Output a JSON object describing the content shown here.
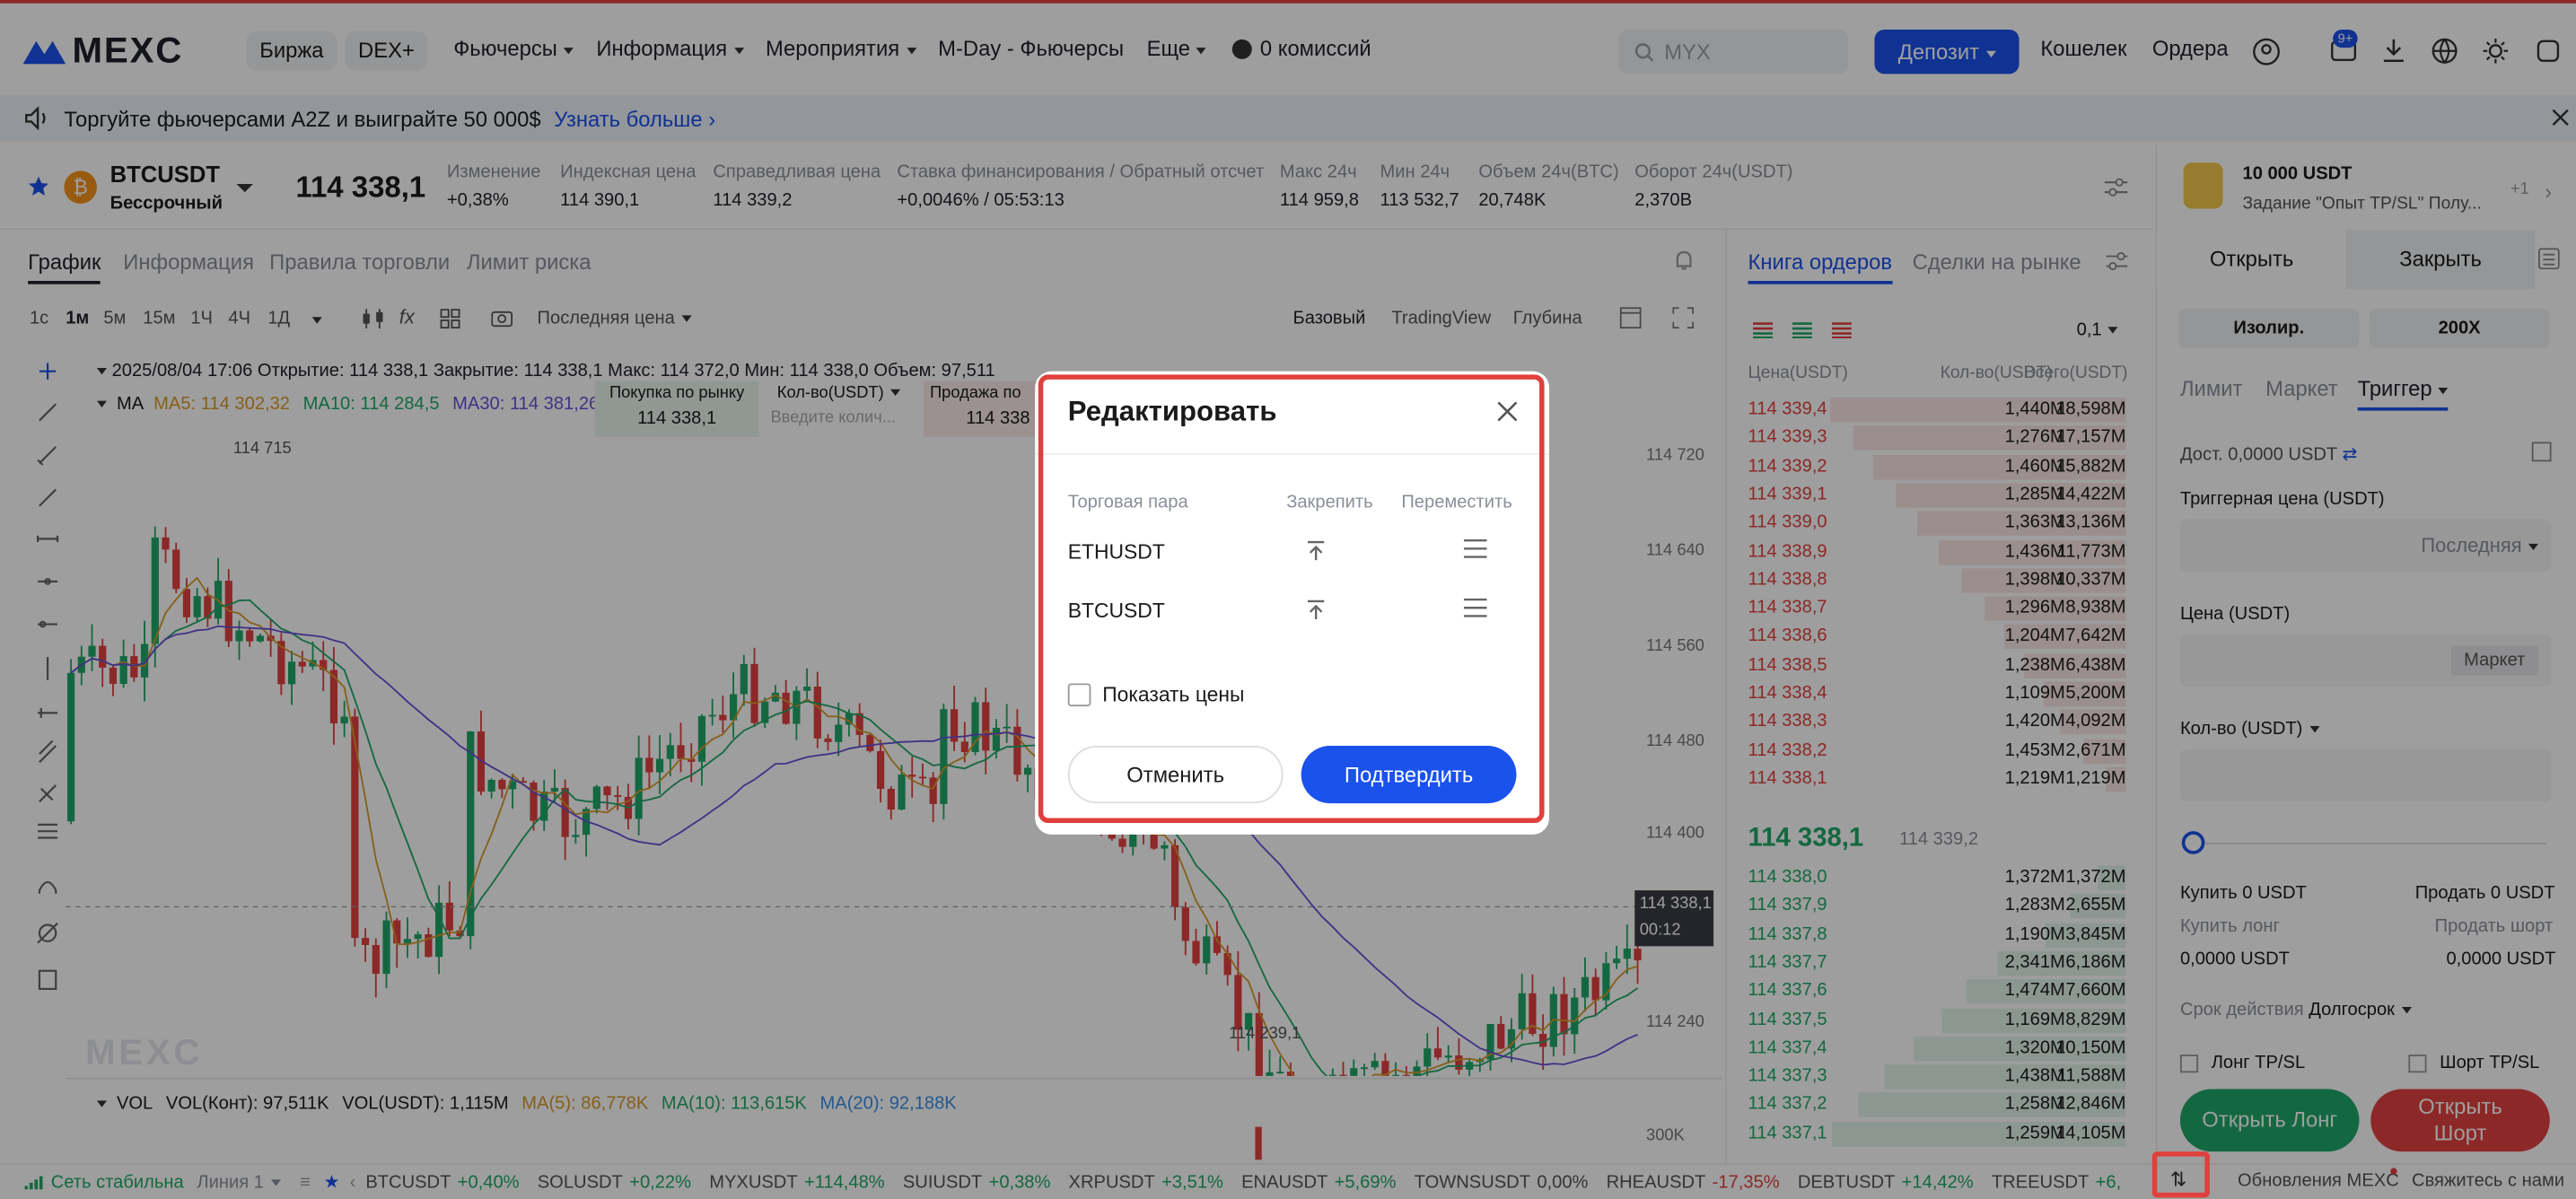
{
  "nav": {
    "logo": "MEXC",
    "items": [
      "Биржа",
      "DEX+",
      "Фьючерсы",
      "Информация",
      "Мероприятия",
      "M-Day - Фьючерсы",
      "Еще",
      "0 комиссий"
    ],
    "search_placeholder": "MYX",
    "deposit": "Депозит",
    "wallet": "Кошелек",
    "orders": "Ордера",
    "badge": "9+"
  },
  "banner": {
    "text": "Торгуйте фьючерсами A2Z и выиграйте 50 000$",
    "link": "Узнать больше"
  },
  "ticker": {
    "symbol": "BTCUSDT",
    "type": "Бессрочный",
    "price": "114 338,1",
    "stats": [
      {
        "label": "Изменение",
        "value": "+0,38%"
      },
      {
        "label": "Индексная цена",
        "value": "114 390,1"
      },
      {
        "label": "Справедливая цена",
        "value": "114 339,2"
      },
      {
        "label": "Ставка финансирования / Обратный отсчет",
        "value": "+0,0046% / 05:53:13"
      },
      {
        "label": "Макс 24ч",
        "value": "114 959,8"
      },
      {
        "label": "Мин 24ч",
        "value": "113 532,7"
      },
      {
        "label": "Объем 24ч(BTC)",
        "value": "20,748K"
      },
      {
        "label": "Оборот 24ч(USDT)",
        "value": "2,370B"
      }
    ]
  },
  "chart": {
    "tabs": [
      "График",
      "Информация",
      "Правила торговли",
      "Лимит риска"
    ],
    "timeframes": [
      "1с",
      "1м",
      "5м",
      "15м",
      "1Ч",
      "4Ч",
      "1Д"
    ],
    "price_type": "Последняя цена",
    "views": [
      "Базовый",
      "TradingView",
      "Глубина"
    ],
    "ohlc": "2025/08/04 17:06 Открытие: 114 338,1 Закрытие: 114 338,1 Макс: 114 372,0 Мин: 114 338,0 Объем: 97,511",
    "ma": {
      "label": "MA",
      "ma5": "MA5: 114 302,32",
      "ma10": "MA10: 114 284,5",
      "ma30": "MA30: 114 381,26"
    },
    "quick": {
      "buy": "Покупка по рынку",
      "qty": "Кол-во(USDT)",
      "sell": "Продажа по",
      "buy_price": "114 338,1",
      "qty_placeholder": "Введите колич...",
      "sell_price": "114 338"
    },
    "price_axis": [
      "114 720",
      "114 640",
      "114 560",
      "114 480",
      "114 400",
      "114 240"
    ],
    "high_label": "114 715",
    "low_label": "114 239,1",
    "last_price_tag": "114 338,1",
    "countdown": "00:12",
    "vol": {
      "label": "VOL",
      "kont": "VOL(Конт): 97,511K",
      "usdt": "VOL(USDT): 1,115M",
      "ma5": "MA(5): 86,778K",
      "ma10": "MA(10): 113,615K",
      "ma20": "MA(20): 92,188K",
      "axis": "300K"
    }
  },
  "orderbook": {
    "tabs": [
      "Книга ордеров",
      "Сделки на рынке"
    ],
    "step": "0,1",
    "headers": [
      "Цена(USDT)",
      "Кол-во(USDT)",
      "Всего(USDT)"
    ],
    "asks": [
      [
        "114 339,4",
        "1,440M",
        "18,598M"
      ],
      [
        "114 339,3",
        "1,276M",
        "17,157M"
      ],
      [
        "114 339,2",
        "1,460M",
        "15,882M"
      ],
      [
        "114 339,1",
        "1,285M",
        "14,422M"
      ],
      [
        "114 339,0",
        "1,363M",
        "13,136M"
      ],
      [
        "114 338,9",
        "1,436M",
        "11,773M"
      ],
      [
        "114 338,8",
        "1,398M",
        "10,337M"
      ],
      [
        "114 338,7",
        "1,296M",
        "8,938M"
      ],
      [
        "114 338,6",
        "1,204M",
        "7,642M"
      ],
      [
        "114 338,5",
        "1,238M",
        "6,438M"
      ],
      [
        "114 338,4",
        "1,109M",
        "5,200M"
      ],
      [
        "114 338,3",
        "1,420M",
        "4,092M"
      ],
      [
        "114 338,2",
        "1,453M",
        "2,671M"
      ],
      [
        "114 338,1",
        "1,219M",
        "1,219M"
      ]
    ],
    "mid": "114 338,1",
    "mid_sub": "114 339,2",
    "bids": [
      [
        "114 338,0",
        "1,372M",
        "1,372M"
      ],
      [
        "114 337,9",
        "1,283M",
        "2,655M"
      ],
      [
        "114 337,8",
        "1,190M",
        "3,845M"
      ],
      [
        "114 337,7",
        "2,341M",
        "6,186M"
      ],
      [
        "114 337,6",
        "1,474M",
        "7,660M"
      ],
      [
        "114 337,5",
        "1,169M",
        "8,829M"
      ],
      [
        "114 337,4",
        "1,320M",
        "10,150M"
      ],
      [
        "114 337,3",
        "1,438M",
        "11,588M"
      ],
      [
        "114 337,2",
        "1,258M",
        "12,846M"
      ],
      [
        "114 337,1",
        "1,259M",
        "14,105M"
      ]
    ]
  },
  "panel": {
    "promo_title": "10 000 USDT",
    "promo_sub": "Задание \"Опыт TP/SL\" Полу...",
    "promo_count": "+1",
    "tabs": [
      "Открыть",
      "Закрыть"
    ],
    "margin": "Изолир.",
    "leverage": "200X",
    "types": [
      "Лимит",
      "Маркет",
      "Триггер"
    ],
    "available": "Дост. 0,0000 USDT",
    "trigger_label": "Триггерная цена (USDT)",
    "trigger_type": "Последняя",
    "price_label": "Цена (USDT)",
    "market_btn": "Маркет",
    "qty_label": "Кол-во (USDT)",
    "buy": "Купить 0 USDT",
    "sell": "Продать 0 USDT",
    "buy_long": "Купить лонг",
    "sell_short": "Продать шорт",
    "long_val": "0,0000 USDT",
    "short_val": "0,0000 USDT",
    "tif_label": "Срок действия",
    "tif": "Долгосрок",
    "long_tpsl": "Лонг TP/SL",
    "short_tpsl": "Шорт TP/SL",
    "open_long": "Открыть Лонг",
    "open_short": "Открыть Шорт"
  },
  "footer": {
    "network": "Сеть стабильна",
    "line": "Линия 1",
    "tickers": [
      [
        "BTCUSDT",
        "+0,40%"
      ],
      [
        "SOLUSDT",
        "+0,22%"
      ],
      [
        "MYXUSDT",
        "+114,48%"
      ],
      [
        "SUIUSDT",
        "+0,38%"
      ],
      [
        "XRPUSDT",
        "+3,51%"
      ],
      [
        "ENAUSDT",
        "+5,69%"
      ],
      [
        "TOWNSUSDT",
        "0,00%"
      ],
      [
        "RHEAUSDT",
        "-17,35%"
      ],
      [
        "DEBTUSDT",
        "+14,42%"
      ],
      [
        "TREEUSDT",
        "+6,"
      ]
    ],
    "updates": "Обновления MEXC",
    "contact": "Свяжитесь с нами"
  },
  "modal": {
    "title": "Редактировать",
    "col_pair": "Торговая пара",
    "col_pin": "Закрепить",
    "col_move": "Переместить",
    "rows": [
      {
        "pair": "ETHUSDT"
      },
      {
        "pair": "BTCUSDT"
      }
    ],
    "show_prices": "Показать цены",
    "cancel": "Отменить",
    "confirm": "Подтвердить"
  }
}
